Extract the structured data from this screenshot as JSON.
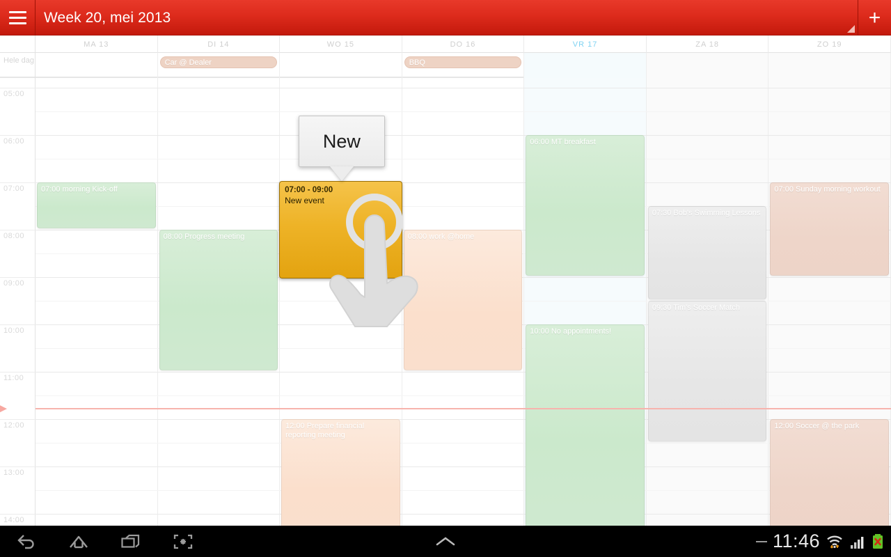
{
  "appbar": {
    "menu_icon": "hamburger-menu-icon",
    "title": "Week 20, mei 2013",
    "add_label": "+",
    "resize_handle_icon": "resize-handle-icon"
  },
  "grid": {
    "allday_label": "Hele dag",
    "hour_labels": [
      "05:00",
      "06:00",
      "07:00",
      "08:00",
      "09:00",
      "10:00",
      "11:00",
      "12:00",
      "13:00",
      "14:00"
    ],
    "now_time": "11:46"
  },
  "days": [
    {
      "label": "MA 13",
      "weekend": false,
      "today": false
    },
    {
      "label": "DI 14",
      "weekend": false,
      "today": false
    },
    {
      "label": "WO 15",
      "weekend": false,
      "today": false
    },
    {
      "label": "DO 16",
      "weekend": false,
      "today": false
    },
    {
      "label": "VR 17",
      "weekend": false,
      "today": true
    },
    {
      "label": "ZA 18",
      "weekend": true,
      "today": false
    },
    {
      "label": "ZO 19",
      "weekend": true,
      "today": false
    }
  ],
  "allday_events": [
    {
      "day": 1,
      "title": "Car @ Dealer"
    },
    {
      "day": 3,
      "title": "BBQ"
    }
  ],
  "events": [
    {
      "day": 0,
      "title": "07:00 morning Kick-off",
      "start": "07:00",
      "end": "08:00",
      "color": "green"
    },
    {
      "day": 1,
      "title": "08:00 Progress meeting",
      "start": "08:00",
      "end": "11:00",
      "color": "green"
    },
    {
      "day": 2,
      "title": "12:00 Prepare financial reporting meeting",
      "start": "12:00",
      "end": "14:30",
      "color": "peach"
    },
    {
      "day": 3,
      "title": "08:00 work @home",
      "start": "08:00",
      "end": "11:00",
      "color": "peach"
    },
    {
      "day": 4,
      "title": "06:00 MT breakfast",
      "start": "06:00",
      "end": "09:00",
      "color": "green"
    },
    {
      "day": 4,
      "title": "10:00 No appointments!",
      "start": "10:00",
      "end": "14:30",
      "color": "green"
    },
    {
      "day": 5,
      "title": "07:30 Bob's Swimming Lessons",
      "start": "07:30",
      "end": "09:30",
      "color": "gray"
    },
    {
      "day": 5,
      "title": "09:30 Tim's Soccer Match",
      "start": "09:30",
      "end": "12:30",
      "color": "gray"
    },
    {
      "day": 6,
      "title": "07:00 Sunday morning workout",
      "start": "07:00",
      "end": "09:00",
      "color": "rose"
    },
    {
      "day": 6,
      "title": "12:00 Soccer @ the park",
      "start": "12:00",
      "end": "14:30",
      "color": "rose"
    }
  ],
  "new_event": {
    "day": 2,
    "time_range": "07:00 - 09:00",
    "title": "New event",
    "callout_label": "New",
    "touch_icon": "touch-hand-icon",
    "accent_color": "#eeb327"
  },
  "systembar": {
    "back_icon": "back-icon",
    "home_icon": "home-icon",
    "recents_icon": "recent-apps-icon",
    "screenshot_icon": "screenshot-icon",
    "up_icon": "chevron-up-icon",
    "clock": "11:46",
    "wifi_icon": "wifi-icon",
    "signal_icon": "cellular-signal-icon",
    "battery_icon": "battery-error-icon"
  }
}
